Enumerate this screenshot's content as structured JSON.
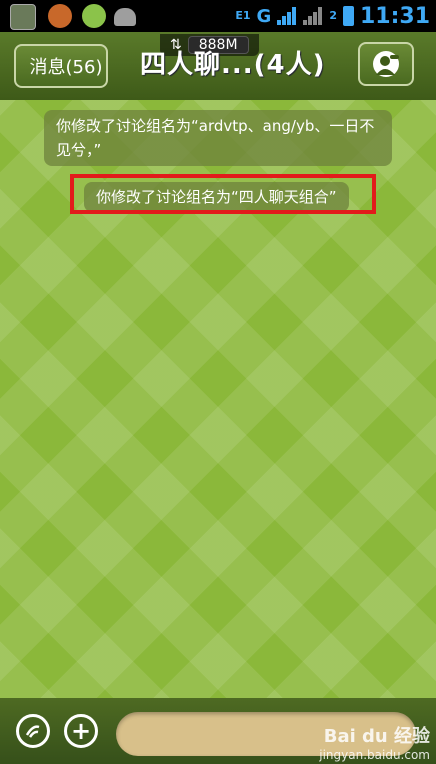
{
  "status_bar": {
    "network_small": "E1",
    "network_type": "G",
    "sim2_label": "2",
    "time": "11:31"
  },
  "header": {
    "back_label": "消息(56)",
    "title": "四人聊...(4人)",
    "traffic_value": "888M"
  },
  "messages": [
    {
      "text": "你修改了讨论组名为“ardvtp、ang/yb、一日不见兮，”"
    },
    {
      "text": "你修改了讨论组名为“四人聊天组合”"
    }
  ],
  "watermark": {
    "brand": "Bai du 经验",
    "url": "jingyan.baidu.com"
  },
  "colors": {
    "accent": "#3fa9f5",
    "highlight": "#e21b1b",
    "chat_bg": "#8bb83a"
  }
}
